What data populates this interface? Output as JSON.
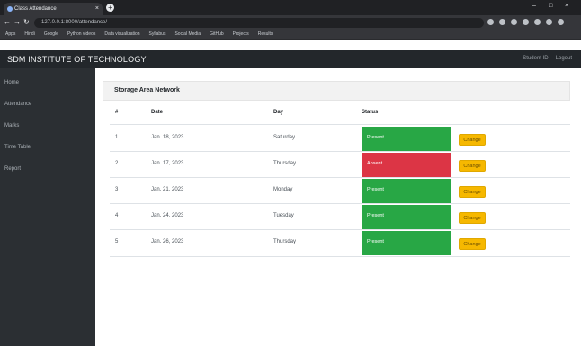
{
  "browser": {
    "tab_title": "Class Attendance",
    "tab_close": "×",
    "new_tab": "+",
    "window_controls": [
      "–",
      "□",
      "×"
    ],
    "nav": {
      "back": "←",
      "forward": "→",
      "reload": "↻"
    },
    "address": "127.0.0.1:8000/attendance/",
    "bookmarks": [
      "Apps",
      "Hindi",
      "Google",
      "Python videos",
      "Data visualization",
      "Syllabus",
      "Social Media",
      "GitHub",
      "Projects",
      "Results"
    ]
  },
  "navbar": {
    "brand": "SDM INSTITUTE OF TECHNOLOGY",
    "links": [
      "Student ID",
      "Logout"
    ]
  },
  "sidebar": {
    "items": [
      "Home",
      "Attendance",
      "Marks",
      "Time Table",
      "Report"
    ]
  },
  "card": {
    "title": "Storage Area Network"
  },
  "table": {
    "headers": [
      "#",
      "Date",
      "Day",
      "Status"
    ],
    "rows": [
      {
        "num": "1",
        "date": "Jan. 18, 2023",
        "day": "Saturday",
        "status": "Present",
        "action": "Change"
      },
      {
        "num": "2",
        "date": "Jan. 17, 2023",
        "day": "Thursday",
        "status": "Absent",
        "action": "Change"
      },
      {
        "num": "3",
        "date": "Jan. 21, 2023",
        "day": "Monday",
        "status": "Present",
        "action": "Change"
      },
      {
        "num": "4",
        "date": "Jan. 24, 2023",
        "day": "Tuesday",
        "status": "Present",
        "action": "Change"
      },
      {
        "num": "5",
        "date": "Jan. 26, 2023",
        "day": "Thursday",
        "status": "Present",
        "action": "Change"
      }
    ]
  },
  "colors": {
    "present": "#28a745",
    "absent": "#dc3545",
    "change_button": "#f6b800",
    "navbar": "#23272b",
    "sidebar": "#2b2f33"
  }
}
